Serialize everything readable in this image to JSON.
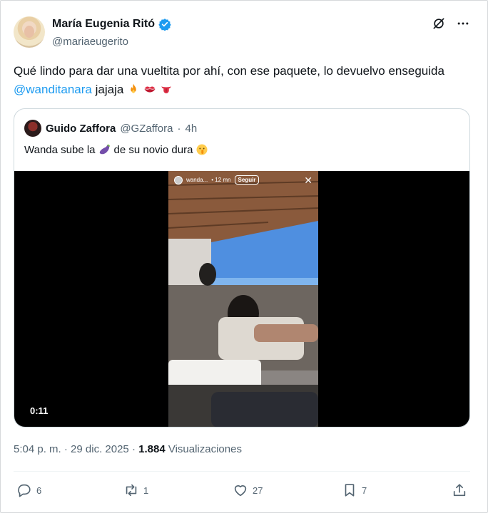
{
  "author": {
    "display_name": "María Eugenia Ritó",
    "handle": "@mariaeugerito",
    "verified_icon": "verified-badge-icon"
  },
  "tweet": {
    "text_part1": "Qué lindo para dar una vueltita por ahí, con ese paquete, lo devuelvo enseguida ",
    "mention": "@wanditanara",
    "text_part2": " jajaja",
    "trailing_emojis": [
      "fire",
      "kiss-mark",
      "tongue"
    ]
  },
  "quoted": {
    "display_name": "Guido Zaffora",
    "handle": "@GZaffora",
    "separator": "·",
    "time": "4h",
    "text_part1": "Wanda sube la",
    "text_part2": "de su novio dura",
    "emojis": [
      "eggplant",
      "shushing-face"
    ],
    "video": {
      "duration": "0:11",
      "story_user": "wanda...",
      "story_time": "• 12 mn",
      "story_follow": "Seguir",
      "story_close": "✕"
    }
  },
  "meta": {
    "time": "5:04 p. m.",
    "sep1": " · ",
    "date": "29 dic. 2025",
    "sep2": " · ",
    "views_count": "1.884",
    "views_label": " Visualizaciones"
  },
  "actions": {
    "replies": "6",
    "retweets": "1",
    "likes": "27",
    "bookmarks": "7"
  },
  "colors": {
    "accent": "#1d9bf0",
    "text": "#0f1419",
    "secondary": "#536471",
    "border": "#cfd9de"
  }
}
